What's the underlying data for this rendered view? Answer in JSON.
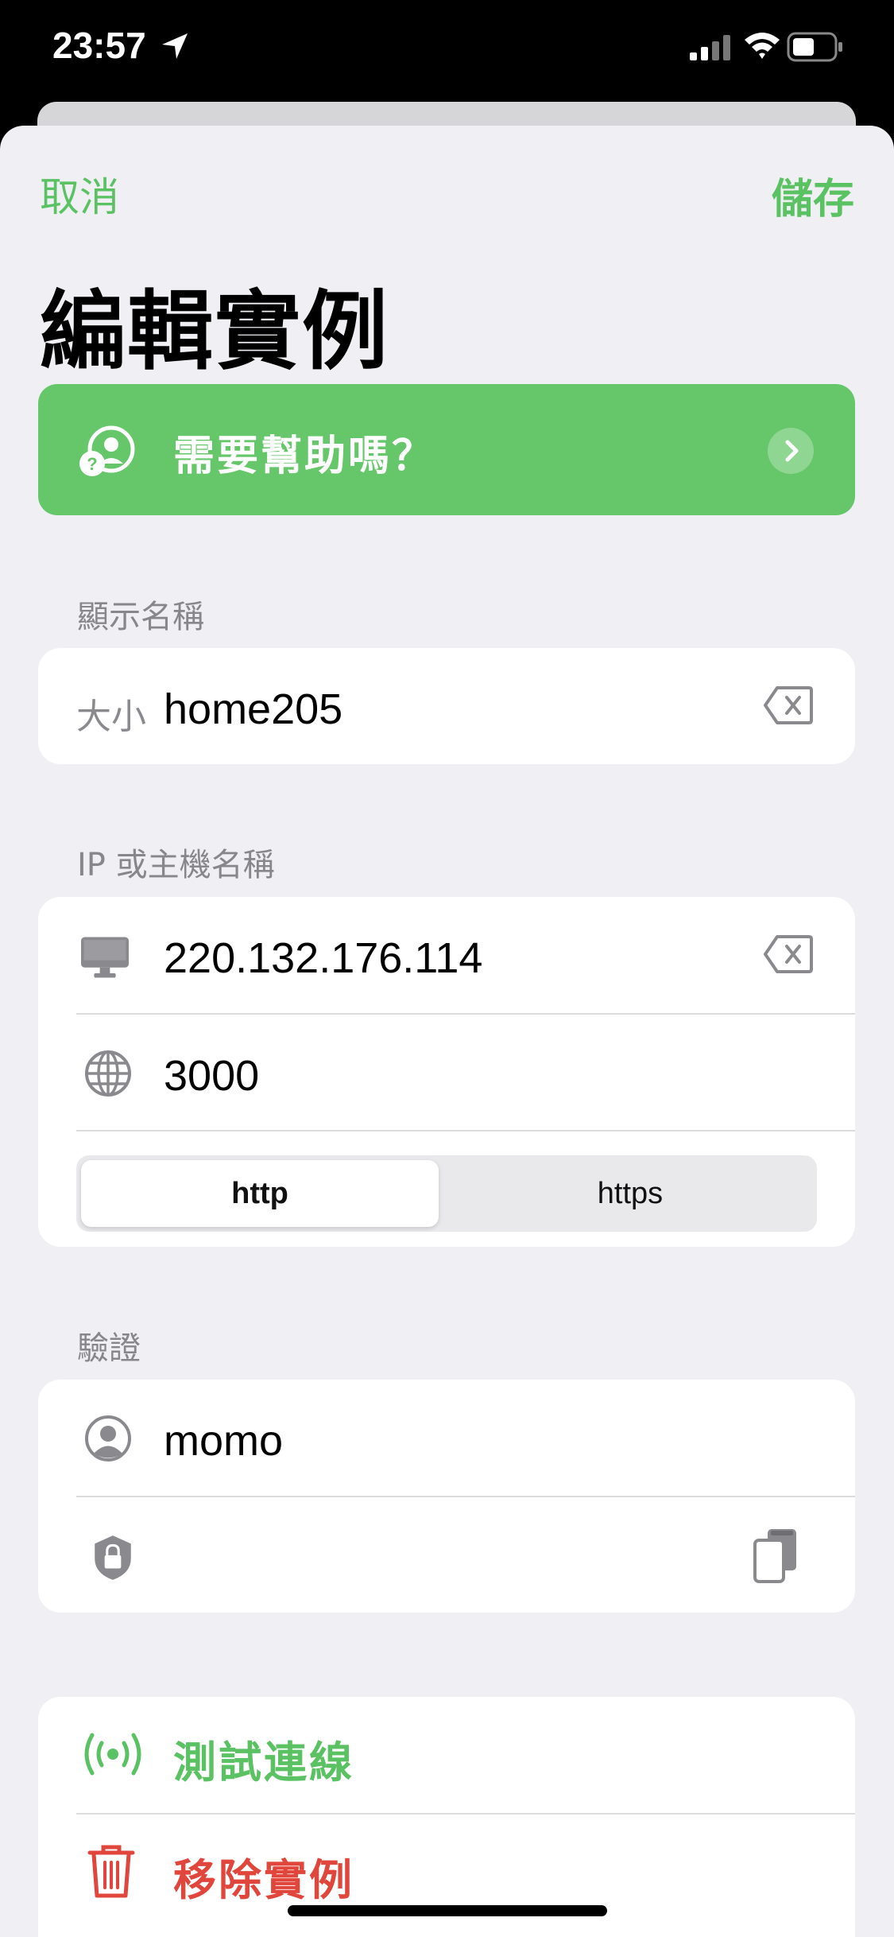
{
  "status_bar": {
    "time": "23:57"
  },
  "nav": {
    "cancel_label": "取消",
    "save_label": "儲存",
    "title": "編輯實例"
  },
  "help_banner": {
    "label": "需要幫助嗎？"
  },
  "display_name": {
    "section_label": "顯示名稱",
    "prefix": "大小",
    "value": "home205"
  },
  "host": {
    "section_label": "IP 或主機名稱",
    "ip_value": "220.132.176.114",
    "port_value": "3000",
    "protocols": [
      "http",
      "https"
    ],
    "selected_protocol": "http"
  },
  "auth": {
    "section_label": "驗證",
    "username_value": "momo",
    "password_value": ""
  },
  "actions": {
    "test_label": "測試連線",
    "remove_label": "移除實例"
  },
  "colors": {
    "accent": "#5bc263",
    "banner": "#66c66a",
    "destructive": "#e0463b",
    "background": "#efeff4"
  }
}
